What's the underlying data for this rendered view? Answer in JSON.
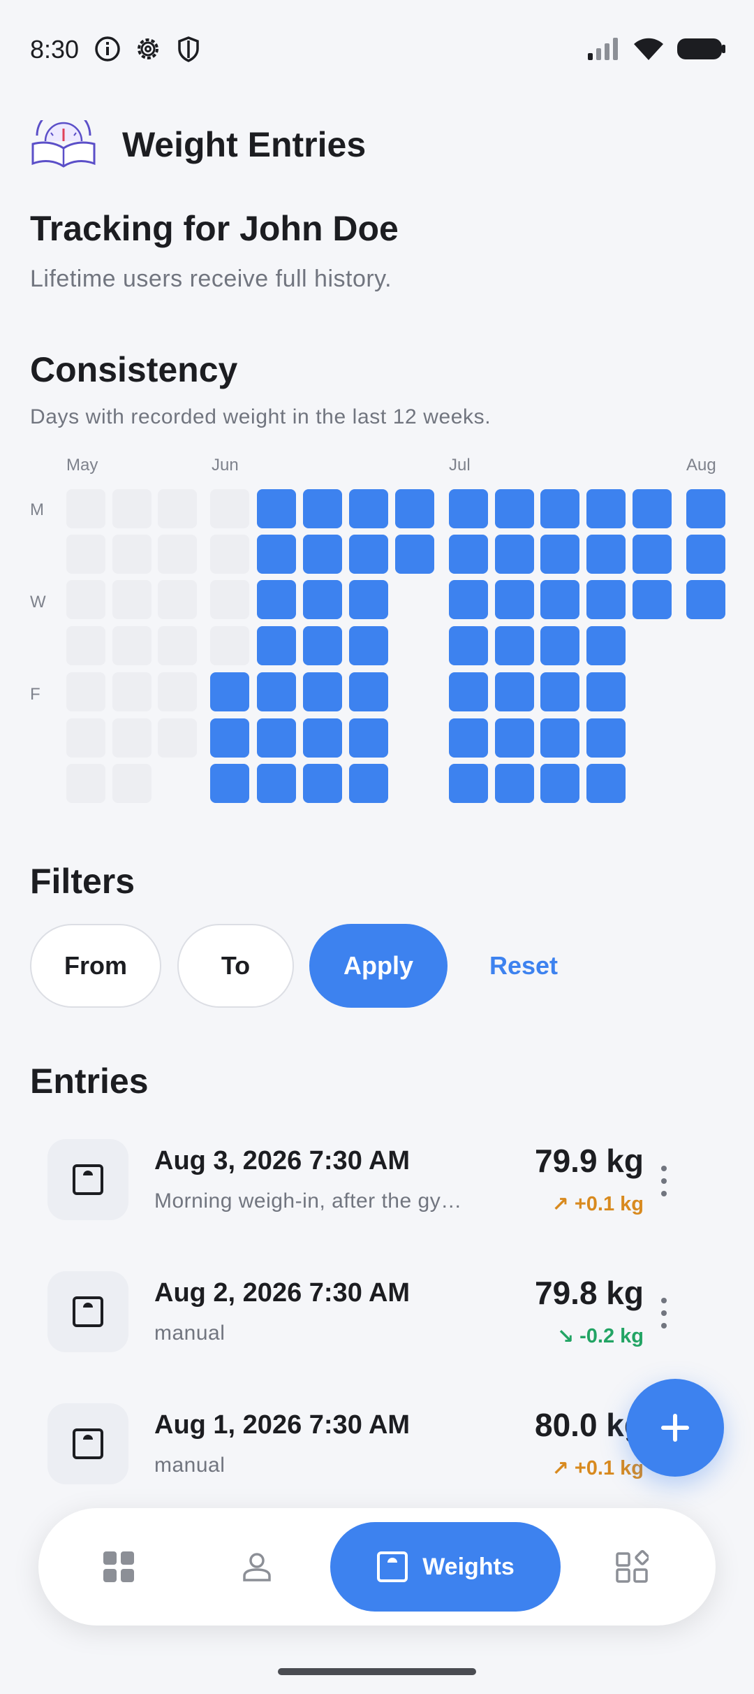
{
  "status_bar": {
    "time": "8:30",
    "icons": [
      "info-icon",
      "gear-icon",
      "shield-icon"
    ],
    "right_icons": [
      "signal-icon",
      "wifi-icon",
      "battery-icon"
    ]
  },
  "header": {
    "title": "Weight Entries",
    "logo": "scale-book-logo"
  },
  "tracking": {
    "title": "Tracking for John Doe",
    "subtitle": "Lifetime users receive full history."
  },
  "consistency": {
    "title": "Consistency",
    "subtitle": "Days with recorded weight in the last 12 weeks.",
    "months": [
      "May",
      "Jun",
      "Jul",
      "Aug"
    ],
    "day_labels": [
      "M",
      "W",
      "F"
    ],
    "weeks": [
      [
        0,
        0,
        0,
        0,
        0,
        0,
        0
      ],
      [
        0,
        0,
        0,
        0,
        0,
        0,
        0
      ],
      [
        0,
        0,
        0,
        0,
        0,
        0,
        null
      ],
      [
        0,
        0,
        0,
        0,
        1,
        1,
        1
      ],
      [
        1,
        1,
        1,
        1,
        1,
        1,
        1
      ],
      [
        1,
        1,
        1,
        1,
        1,
        1,
        1
      ],
      [
        1,
        1,
        1,
        1,
        1,
        1,
        1
      ],
      [
        1,
        1,
        null,
        null,
        null,
        null,
        null
      ],
      [
        1,
        1,
        1,
        1,
        1,
        1,
        1
      ],
      [
        1,
        1,
        1,
        1,
        1,
        1,
        1
      ],
      [
        1,
        1,
        1,
        1,
        1,
        1,
        1
      ],
      [
        1,
        1,
        1,
        1,
        1,
        1,
        1
      ],
      [
        1,
        1,
        1,
        null,
        null,
        null,
        null
      ],
      [
        1,
        1,
        1,
        null,
        null,
        null,
        null
      ]
    ],
    "filled_color": "#3d82ef",
    "empty_color": "#edeef2"
  },
  "filters": {
    "title": "Filters",
    "from_label": "From",
    "to_label": "To",
    "apply_label": "Apply",
    "reset_label": "Reset"
  },
  "entries": {
    "title": "Entries",
    "items": [
      {
        "date": "Aug 3, 2026 7:30 AM",
        "note": "Morning weigh-in, after the gy…",
        "weight": "79.9 kg",
        "delta": "+0.1 kg",
        "direction": "up",
        "arrow": "↗"
      },
      {
        "date": "Aug 2, 2026 7:30 AM",
        "note": "manual",
        "weight": "79.8 kg",
        "delta": "-0.2 kg",
        "direction": "down",
        "arrow": "↘"
      },
      {
        "date": "Aug 1, 2026 7:30 AM",
        "note": "manual",
        "weight": "80.0 kg",
        "delta": "+0.1 kg",
        "direction": "up",
        "arrow": "↗"
      }
    ]
  },
  "fab": {
    "icon": "plus-icon"
  },
  "bottom_nav": {
    "items": [
      {
        "name": "dashboard",
        "icon": "grid-icon"
      },
      {
        "name": "profile",
        "icon": "person-icon"
      },
      {
        "name": "weights",
        "icon": "scale-icon",
        "label": "Weights",
        "active": true
      },
      {
        "name": "more",
        "icon": "apps-icon"
      }
    ]
  },
  "colors": {
    "accent": "#3d82ef",
    "up": "#d88a1f",
    "down": "#22a464",
    "background": "#f5f6f9"
  }
}
